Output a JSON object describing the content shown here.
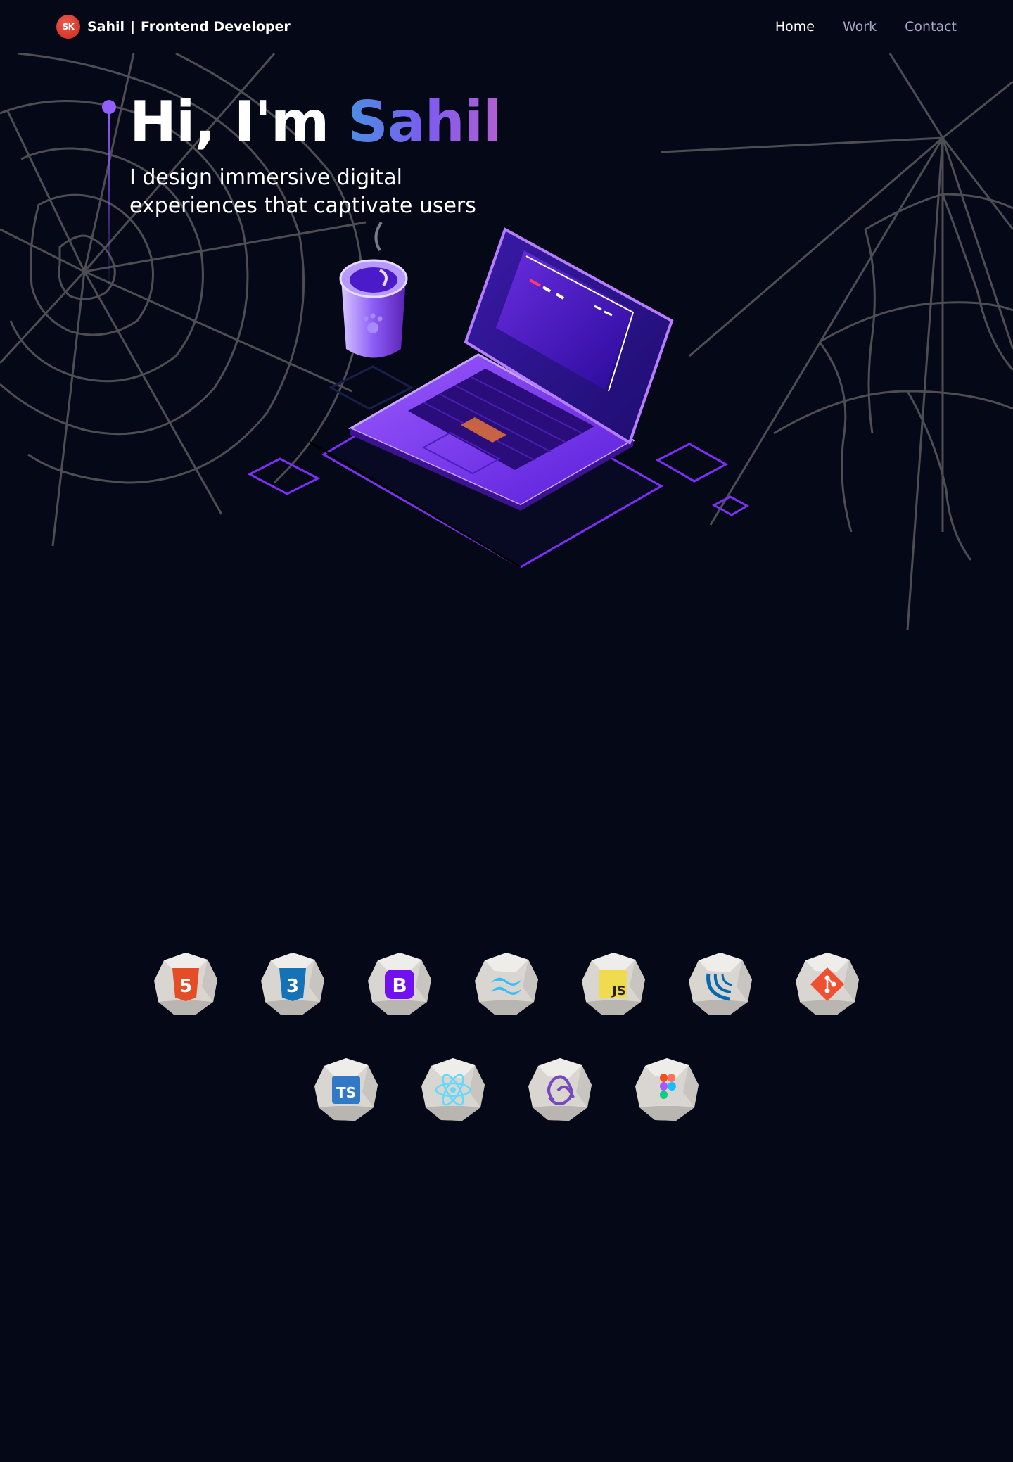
{
  "nav": {
    "logo_text": "SK",
    "name": "Sahil",
    "separator": "|",
    "role": "Frontend Developer",
    "links": [
      {
        "label": "Home",
        "active": true
      },
      {
        "label": "Work",
        "active": false
      },
      {
        "label": "Contact",
        "active": false
      }
    ]
  },
  "hero": {
    "greeting": "Hi, I'm ",
    "name": "Sahil",
    "subtitle": "I design immersive digital experiences that captivate users"
  },
  "tech": {
    "row1": [
      {
        "icon": "html5-icon",
        "label": "5",
        "color": "#e44d26"
      },
      {
        "icon": "css3-icon",
        "label": "3",
        "color": "#1572b6"
      },
      {
        "icon": "bootstrap-icon",
        "label": "B",
        "color": "#7110f0"
      },
      {
        "icon": "tailwind-icon",
        "label": "",
        "color": "#38bdf8"
      },
      {
        "icon": "javascript-icon",
        "label": "JS",
        "color": "#f0db4f"
      },
      {
        "icon": "jquery-icon",
        "label": "",
        "color": "#0769ad"
      },
      {
        "icon": "git-icon",
        "label": "",
        "color": "#f05032"
      }
    ],
    "row2": [
      {
        "icon": "typescript-icon",
        "label": "TS",
        "color": "#3178c6"
      },
      {
        "icon": "react-icon",
        "label": "",
        "color": "#61dafb"
      },
      {
        "icon": "redux-icon",
        "label": "",
        "color": "#764abc"
      },
      {
        "icon": "figma-icon",
        "label": "",
        "color": "#a259ff"
      }
    ]
  },
  "colors": {
    "background": "#050816",
    "accent": "#915eff",
    "nav_inactive": "#aaa6c3",
    "logo": "#d9352a"
  }
}
